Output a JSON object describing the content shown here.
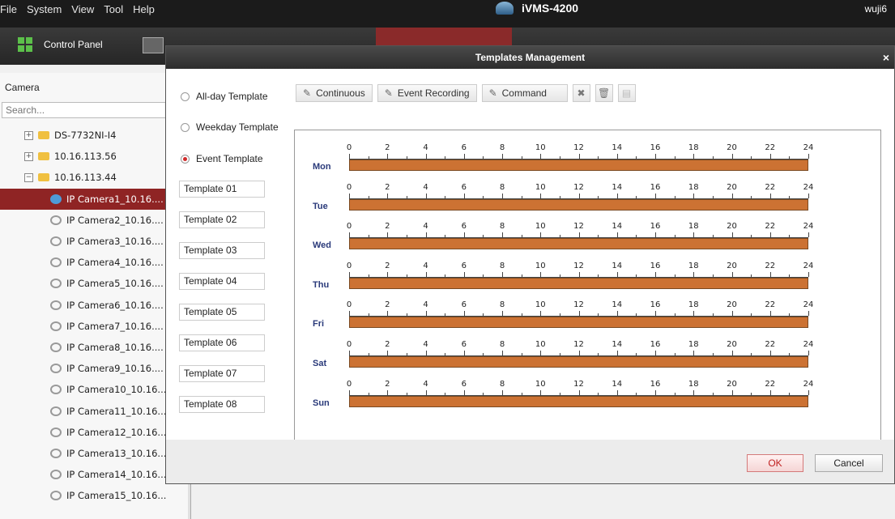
{
  "menu": [
    "File",
    "System",
    "View",
    "Tool",
    "Help"
  ],
  "app_title": "iVMS-4200",
  "user": "wuji6",
  "toolbar": {
    "control_panel": "Control Panel"
  },
  "left": {
    "header": "Camera",
    "search_placeholder": "Search...",
    "tree": [
      {
        "label": "DS-7732NI-I4",
        "type": "device",
        "expander": "+"
      },
      {
        "label": "10.16.113.56",
        "type": "device",
        "expander": "+"
      },
      {
        "label": "10.16.113.44",
        "type": "device",
        "expander": "−"
      },
      {
        "label": "IP Camera1_10.16....",
        "type": "camera",
        "selected": true
      },
      {
        "label": "IP Camera2_10.16....",
        "type": "camera"
      },
      {
        "label": "IP Camera3_10.16....",
        "type": "camera"
      },
      {
        "label": "IP Camera4_10.16....",
        "type": "camera"
      },
      {
        "label": "IP Camera5_10.16....",
        "type": "camera"
      },
      {
        "label": "IP Camera6_10.16....",
        "type": "camera"
      },
      {
        "label": "IP Camera7_10.16....",
        "type": "camera"
      },
      {
        "label": "IP Camera8_10.16....",
        "type": "camera"
      },
      {
        "label": "IP Camera9_10.16....",
        "type": "camera"
      },
      {
        "label": "IP Camera10_10.16...",
        "type": "camera"
      },
      {
        "label": "IP Camera11_10.16...",
        "type": "camera"
      },
      {
        "label": "IP Camera12_10.16...",
        "type": "camera"
      },
      {
        "label": "IP Camera13_10.16...",
        "type": "camera"
      },
      {
        "label": "IP Camera14_10.16...",
        "type": "camera"
      },
      {
        "label": "IP Camera15_10.16...",
        "type": "camera"
      }
    ]
  },
  "dialog": {
    "title": "Templates Management",
    "close": "×",
    "radios": [
      {
        "label": "All-day Template",
        "checked": false
      },
      {
        "label": "Weekday Template",
        "checked": false
      },
      {
        "label": "Event Template",
        "checked": true
      }
    ],
    "templates": [
      "Template 01",
      "Template 02",
      "Template 03",
      "Template 04",
      "Template 05",
      "Template 06",
      "Template 07",
      "Template 08"
    ],
    "buttons": {
      "continuous": "Continuous",
      "event_recording": "Event Recording",
      "command": "Command"
    },
    "icon_buttons": [
      "close-x-icon",
      "delete-icon",
      "copy-icon"
    ],
    "ok": "OK",
    "cancel": "Cancel"
  },
  "schedule": {
    "days": [
      "Mon",
      "Tue",
      "Wed",
      "Thu",
      "Fri",
      "Sat",
      "Sun"
    ],
    "hours": [
      "0",
      "2",
      "4",
      "6",
      "8",
      "10",
      "12",
      "14",
      "16",
      "18",
      "20",
      "22",
      "24"
    ],
    "segment_color": "#cc7233",
    "segments": [
      [
        0,
        24
      ],
      [
        0,
        24
      ],
      [
        0,
        24
      ],
      [
        0,
        24
      ],
      [
        0,
        24
      ],
      [
        0,
        24
      ],
      [
        0,
        24
      ]
    ]
  }
}
